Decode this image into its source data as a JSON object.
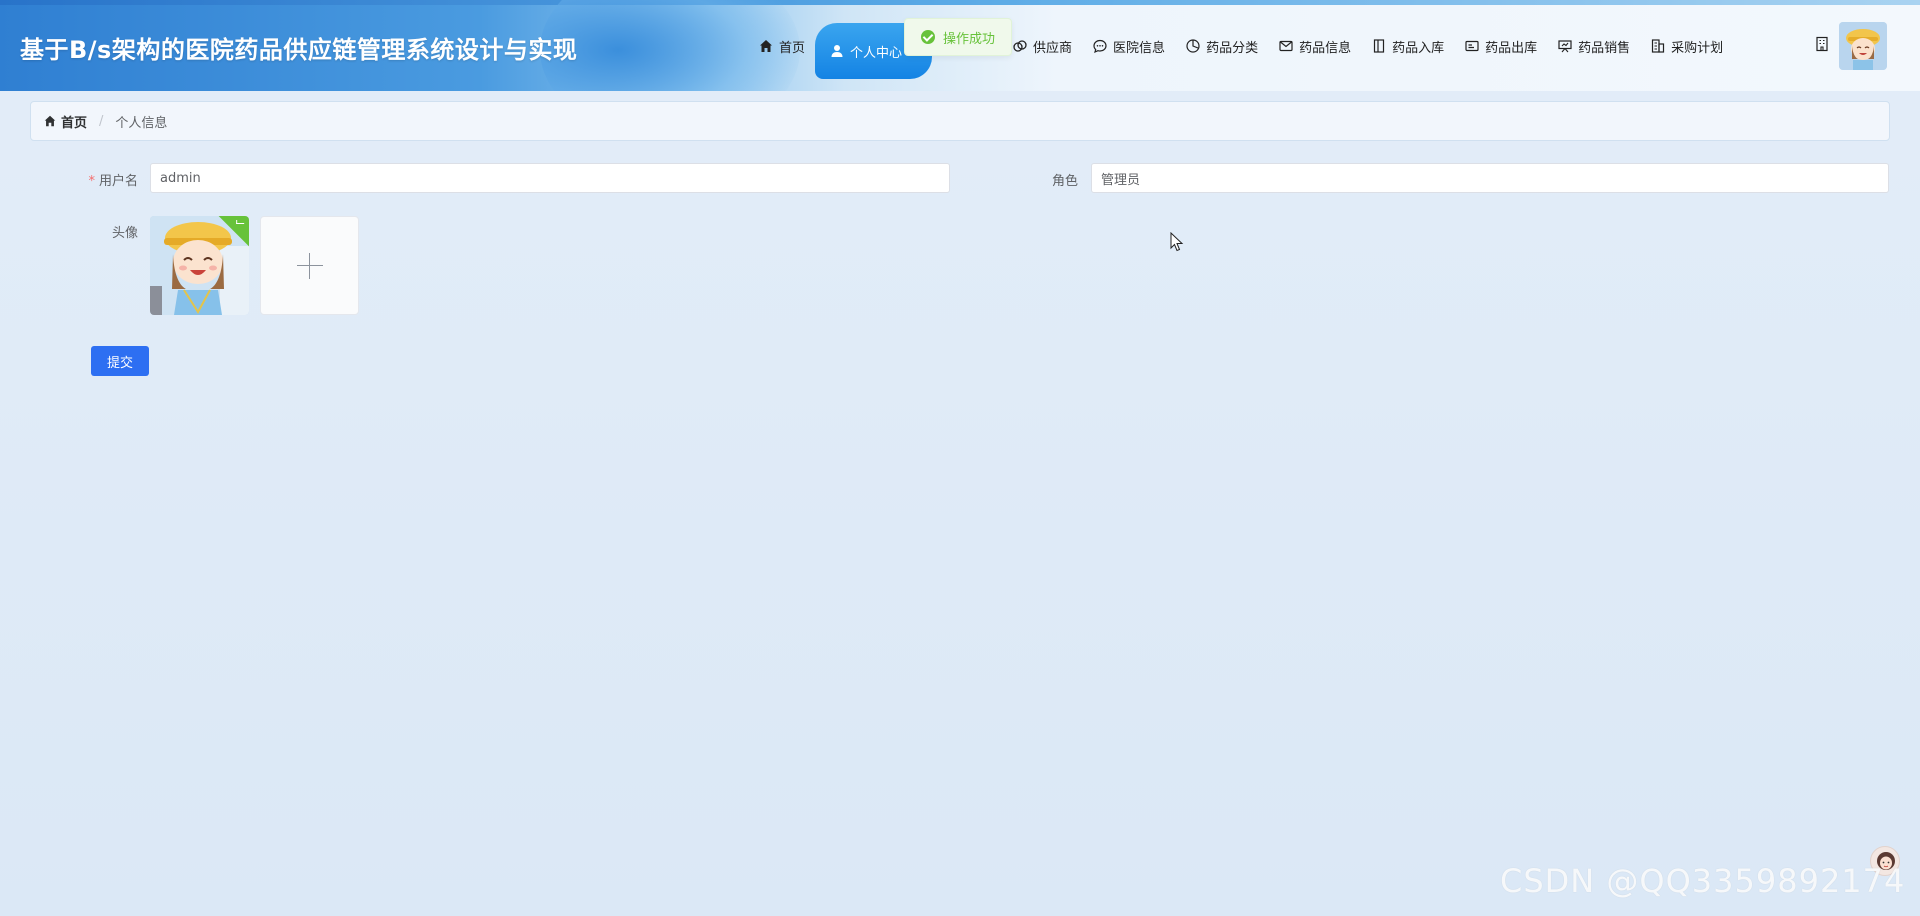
{
  "app": {
    "title": "基于B/s架构的医院药品供应链管理系统设计与实现"
  },
  "nav": {
    "items": [
      {
        "label": "首页",
        "icon": "home-icon"
      },
      {
        "label": "个人中心",
        "icon": "user-icon"
      },
      {
        "label": "供应商",
        "icon": "link-icon"
      },
      {
        "label": "医院信息",
        "icon": "chat-icon"
      },
      {
        "label": "药品分类",
        "icon": "pie-icon"
      },
      {
        "label": "药品信息",
        "icon": "mail-icon"
      },
      {
        "label": "药品入库",
        "icon": "door-icon"
      },
      {
        "label": "药品出库",
        "icon": "card-icon"
      },
      {
        "label": "药品销售",
        "icon": "presentation-icon"
      },
      {
        "label": "采购计划",
        "icon": "office-icon"
      }
    ],
    "active_index": 1
  },
  "toast": {
    "message": "操作成功",
    "type": "success"
  },
  "breadcrumb": {
    "home": "首页",
    "separator": "/",
    "current": "个人信息"
  },
  "form": {
    "username": {
      "label": "用户名",
      "value": "admin",
      "required": true
    },
    "role": {
      "label": "角色",
      "value": "管理员"
    },
    "avatar": {
      "label": "头像"
    },
    "submit_label": "提交"
  },
  "watermark": {
    "text": "CSDN @QQ3359892174"
  },
  "colors": {
    "primary": "#2d6ff2",
    "success": "#67c23a",
    "nav_active": "#1483e4",
    "background": "#dde9f6"
  }
}
